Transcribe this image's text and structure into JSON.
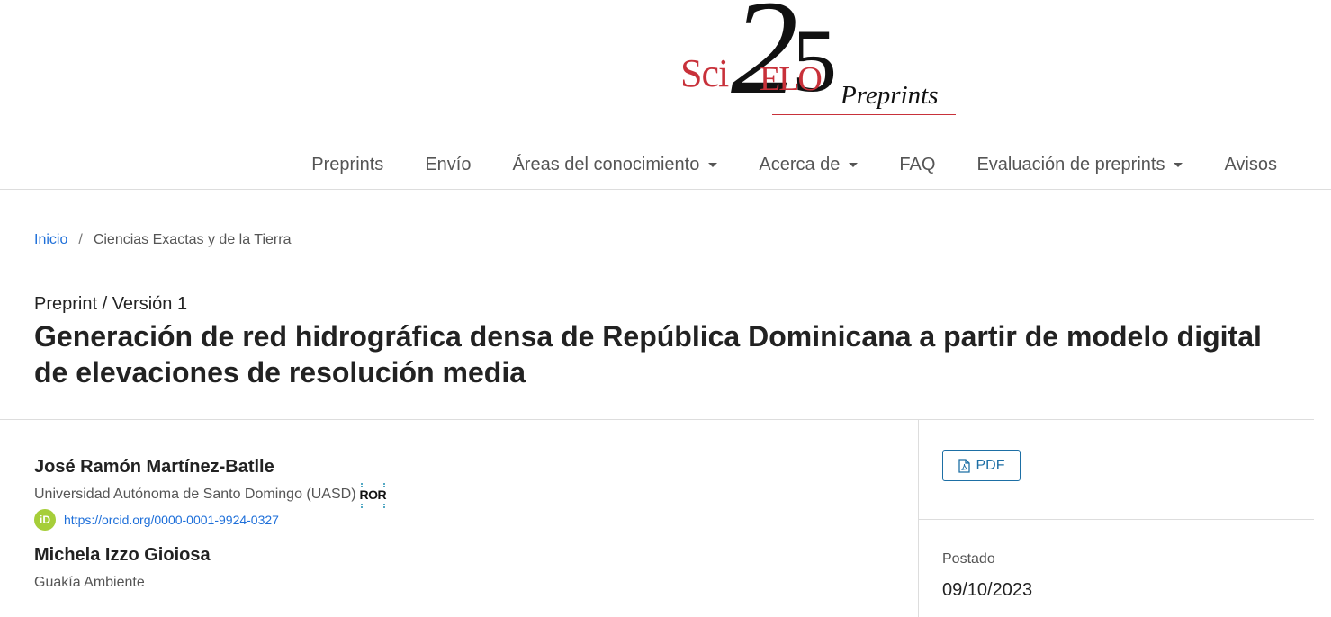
{
  "logo": {
    "sci": "Sci",
    "elo": "ELO",
    "digit_two": "2",
    "digit_five": "5",
    "preprints": "Preprints"
  },
  "nav": {
    "items": [
      {
        "label": "Preprints",
        "dropdown": false
      },
      {
        "label": "Envío",
        "dropdown": false
      },
      {
        "label": "Áreas del conocimiento",
        "dropdown": true
      },
      {
        "label": "Acerca de",
        "dropdown": true
      },
      {
        "label": "FAQ",
        "dropdown": false
      },
      {
        "label": "Evaluación de preprints",
        "dropdown": true
      },
      {
        "label": "Avisos",
        "dropdown": false
      }
    ]
  },
  "breadcrumb": {
    "home": "Inicio",
    "separator": "/",
    "current": "Ciencias Exactas y de la Tierra"
  },
  "article": {
    "kicker": "Preprint / Versión 1",
    "title": "Generación de red hidrográfica densa de República Dominicana a partir de modelo digital de elevaciones de resolución media"
  },
  "authors": [
    {
      "name": "José Ramón Martínez-Batlle",
      "affiliation": "Universidad Autónoma de Santo Domingo (UASD)",
      "ror_label": "ROR",
      "orcid_label": "iD",
      "orcid_url": "https://orcid.org/0000-0001-9924-0327"
    },
    {
      "name": "Michela Izzo Gioiosa",
      "affiliation": "Guakía Ambiente"
    }
  ],
  "sidebar": {
    "pdf_label": "PDF",
    "posted_label": "Postado",
    "posted_date": "09/10/2023"
  },
  "colors": {
    "link": "#1e6fd9",
    "brand_red": "#c8313a",
    "orcid_green": "#a6ce39",
    "pdf_button": "#1d6fa5"
  }
}
